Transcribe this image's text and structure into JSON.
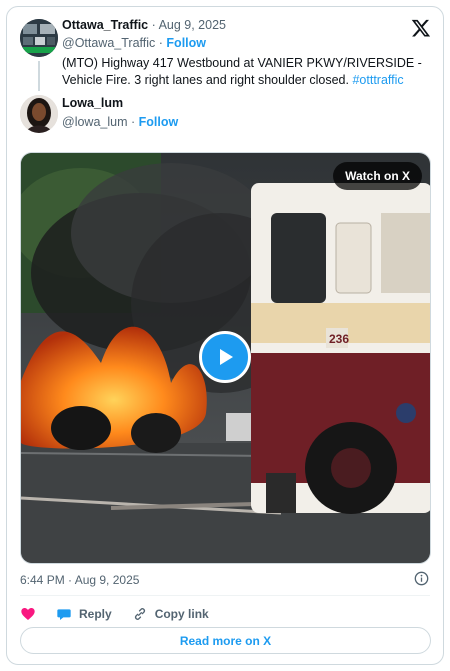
{
  "original_tweet": {
    "display_name": "Ottawa_Traffic",
    "date": "· Aug 9, 2025",
    "handle": "@Ottawa_Traffic",
    "dot": "·",
    "follow_label": "Follow",
    "text": "(MTO) Highway 417 Westbound at VANIER PKWY/RIVERSIDE - Vehicle Fire. 3 right lanes and right shoulder closed.",
    "hashtag": "#otttraffic"
  },
  "reply_author": {
    "display_name": "Lowa_lum",
    "handle": "@lowa_lum",
    "dot": "·",
    "follow_label": "Follow"
  },
  "media": {
    "watch_label": "Watch on X",
    "truck_number": "236",
    "play_icon": "play-icon"
  },
  "meta": {
    "timestamp": "6:44 PM · Aug 9, 2025",
    "info_icon": "info-icon"
  },
  "actions": {
    "like_icon": "heart-icon",
    "reply_label": "Reply",
    "copy_label": "Copy link"
  },
  "read_more_label": "Read more on X",
  "colors": {
    "accent": "#1d9bf0",
    "heart": "#f91880",
    "muted": "#536471",
    "border": "#cfd9de"
  }
}
